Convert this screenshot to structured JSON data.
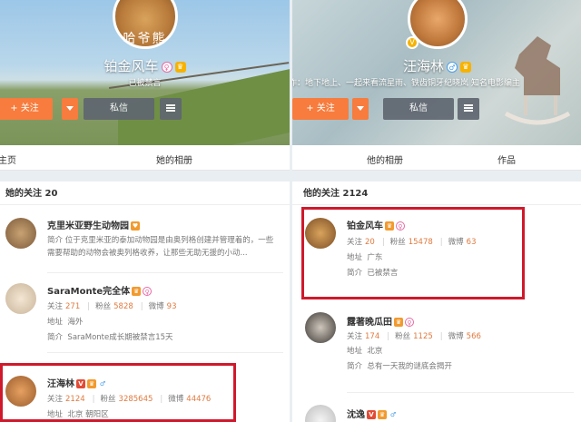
{
  "left": {
    "banner": {
      "avatar_text": "哈爷熊",
      "name": "铂金风车",
      "status": "已被禁言",
      "follow_label": "+ 关注",
      "message_label": "私信"
    },
    "tabs": [
      "主页",
      "她的相册"
    ],
    "list_header": "她的关注 20",
    "entries": [
      {
        "name": "克里米亚野生动物园",
        "desc": "简介  位于克里米亚的泰加动物园是由奥列格创建并管理着的，一些需要帮助的动物会被奥列格收养，让那些无助无援的小动..."
      },
      {
        "name": "SaraMonte完全体",
        "follow_label": "关注",
        "follow": "271",
        "fans_label": "粉丝",
        "fans": "5828",
        "weibo_label": "微博",
        "weibo": "93",
        "address_label": "地址",
        "address": "海外",
        "intro_label": "简介",
        "intro": "SaraMonte成长期被禁言15天"
      },
      {
        "name": "汪海林",
        "follow_label": "关注",
        "follow": "2124",
        "fans_label": "粉丝",
        "fans": "3285645",
        "weibo_label": "微博",
        "weibo": "44476",
        "address_label": "地址",
        "address": "北京 朝阳区"
      }
    ]
  },
  "right": {
    "banner": {
      "name": "汪海林",
      "intro": "作：地下地上、一起来看流星雨、铁齿铜牙纪晓岚 知名电影编主",
      "follow_label": "+ 关注",
      "message_label": "私信"
    },
    "tabs": [
      "他的相册",
      "作品"
    ],
    "list_header": "他的关注 2124",
    "entries": [
      {
        "name": "铂金风车",
        "follow_label": "关注",
        "follow": "20",
        "fans_label": "粉丝",
        "fans": "15478",
        "weibo_label": "微博",
        "weibo": "63",
        "address_label": "地址",
        "address": "广东",
        "intro_label": "简介",
        "intro": "已被禁言"
      },
      {
        "name": "露著晚瓜田",
        "follow_label": "关注",
        "follow": "174",
        "fans_label": "粉丝",
        "fans": "1125",
        "weibo_label": "微博",
        "weibo": "566",
        "address_label": "地址",
        "address": "北京",
        "intro_label": "简介",
        "intro": "总有一天我的谜底会揭开"
      },
      {
        "name": "沈逸"
      }
    ]
  },
  "colors": {
    "accent": "#f77c3d",
    "highlight_box": "#d0192c",
    "number": "#e07a3f"
  }
}
